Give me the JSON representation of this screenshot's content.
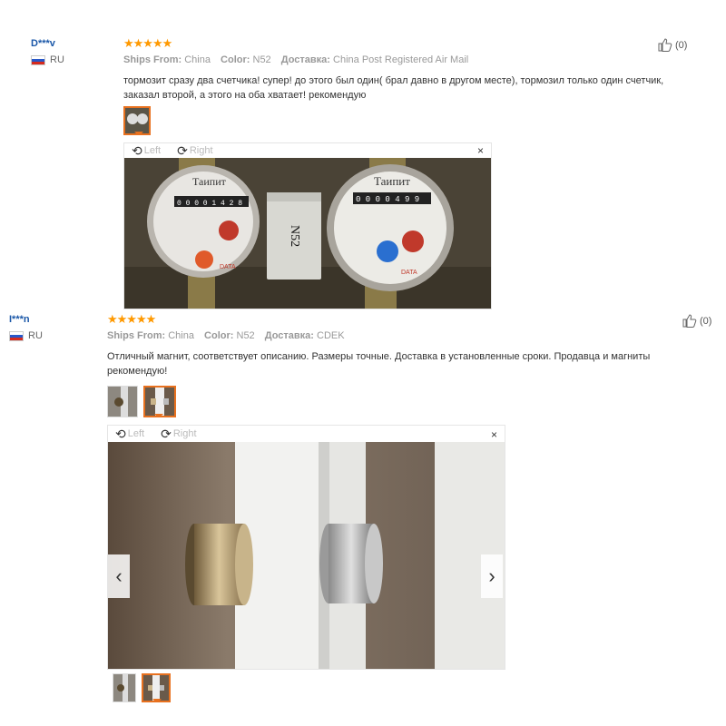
{
  "reviews": [
    {
      "user": "D***v",
      "country": "RU",
      "stars": "★★★★★",
      "ships_from_label": "Ships From:",
      "ships_from": "China",
      "color_label": "Color:",
      "color": "N52",
      "delivery_label": "Доставка:",
      "delivery": "China Post Registered Air Mail",
      "text": "тормозит сразу два счетчика! супер! до этого был один( брал давно в другом месте), тормозил только один счетчик, заказал второй, а этого на оба хватает! рекомендую",
      "likes": "(0)",
      "rotate_left": "Left",
      "rotate_right": "Right",
      "close": "×"
    },
    {
      "user": "I***n",
      "country": "RU",
      "stars": "★★★★★",
      "ships_from_label": "Ships From:",
      "ships_from": "China",
      "color_label": "Color:",
      "color": "N52",
      "delivery_label": "Доставка:",
      "delivery": "CDEK",
      "text": "Отличный магнит, соответствует описанию. Размеры точные. Доставка в установленные сроки. Продавца и магниты рекомендую!",
      "likes": "(0)",
      "rotate_left": "Left",
      "rotate_right": "Right",
      "close": "×",
      "prev": "‹",
      "next": "›"
    }
  ],
  "photo1": {
    "meter_brand": "Таипит",
    "meter_digits_left": "0 0 0 0 1 4 2 8",
    "meter_digits_right": "0 0 0 0 4 9 9",
    "magnet_label": "N52",
    "meter_sub": "DATA"
  },
  "colors": {
    "star": "#ff9900",
    "accent": "#e8711f",
    "username": "#1a57a8"
  }
}
